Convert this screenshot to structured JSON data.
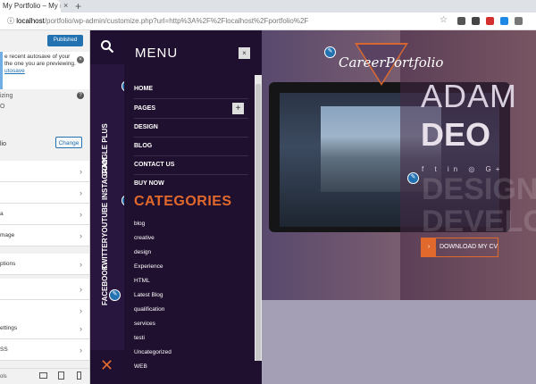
{
  "browser": {
    "tab_title": "My Portfolio – My Po",
    "tab_close": "×",
    "new_tab": "+",
    "url_host": "localhost",
    "url_rest": "/portfolio/wp-admin/customize.php?url=http%3A%2F%2Flocalhost%2Fportfolio%2F",
    "star_icon": "☆"
  },
  "customizer": {
    "publish_label": "Published",
    "notice_lines": [
      "e recent autosave of your",
      "the one you are previewing."
    ],
    "notice_link": "utosave",
    "notice_close": "×",
    "theme_label": "izing",
    "theme_sub": "O",
    "help_icon": "?",
    "active_theme": "lio",
    "change_label": "Change",
    "items": [
      "",
      "",
      "a",
      "mage",
      "ptions",
      "",
      "",
      "ettings",
      "SS"
    ],
    "footer_label": "ols"
  },
  "site": {
    "brand": "CareerPortfolio",
    "name_first": "ADAM",
    "name_last": "DEO",
    "ghost_line1": "DESIGNER",
    "ghost_line2": "DEVELOPER",
    "social_glyphs": "f  t  in  ◎  G+",
    "download_label": "DOWNLOAD MY CV",
    "download_arrow": "›"
  },
  "social": {
    "links": [
      "GOOGLE PLUS",
      "INSTAGRAM",
      "YOUTUBE",
      "TWITTER",
      "FACEBOOK"
    ]
  },
  "menu": {
    "title": "MENU",
    "close": "×",
    "items": [
      "HOME",
      "PAGES",
      "DESIGN",
      "BLOG",
      "CONTACT US",
      "BUY NOW"
    ],
    "plus": "+",
    "categories_title": "CATEGORIES",
    "categories": [
      "blog",
      "creative",
      "design",
      "Experience",
      "HTML",
      "Latest Blog",
      "qualification",
      "services",
      "testi",
      "Uncategorized",
      "WEB"
    ]
  },
  "colors": {
    "accent": "#e1692c",
    "wp_blue": "#2271b1",
    "menu_bg": "#20102f"
  }
}
